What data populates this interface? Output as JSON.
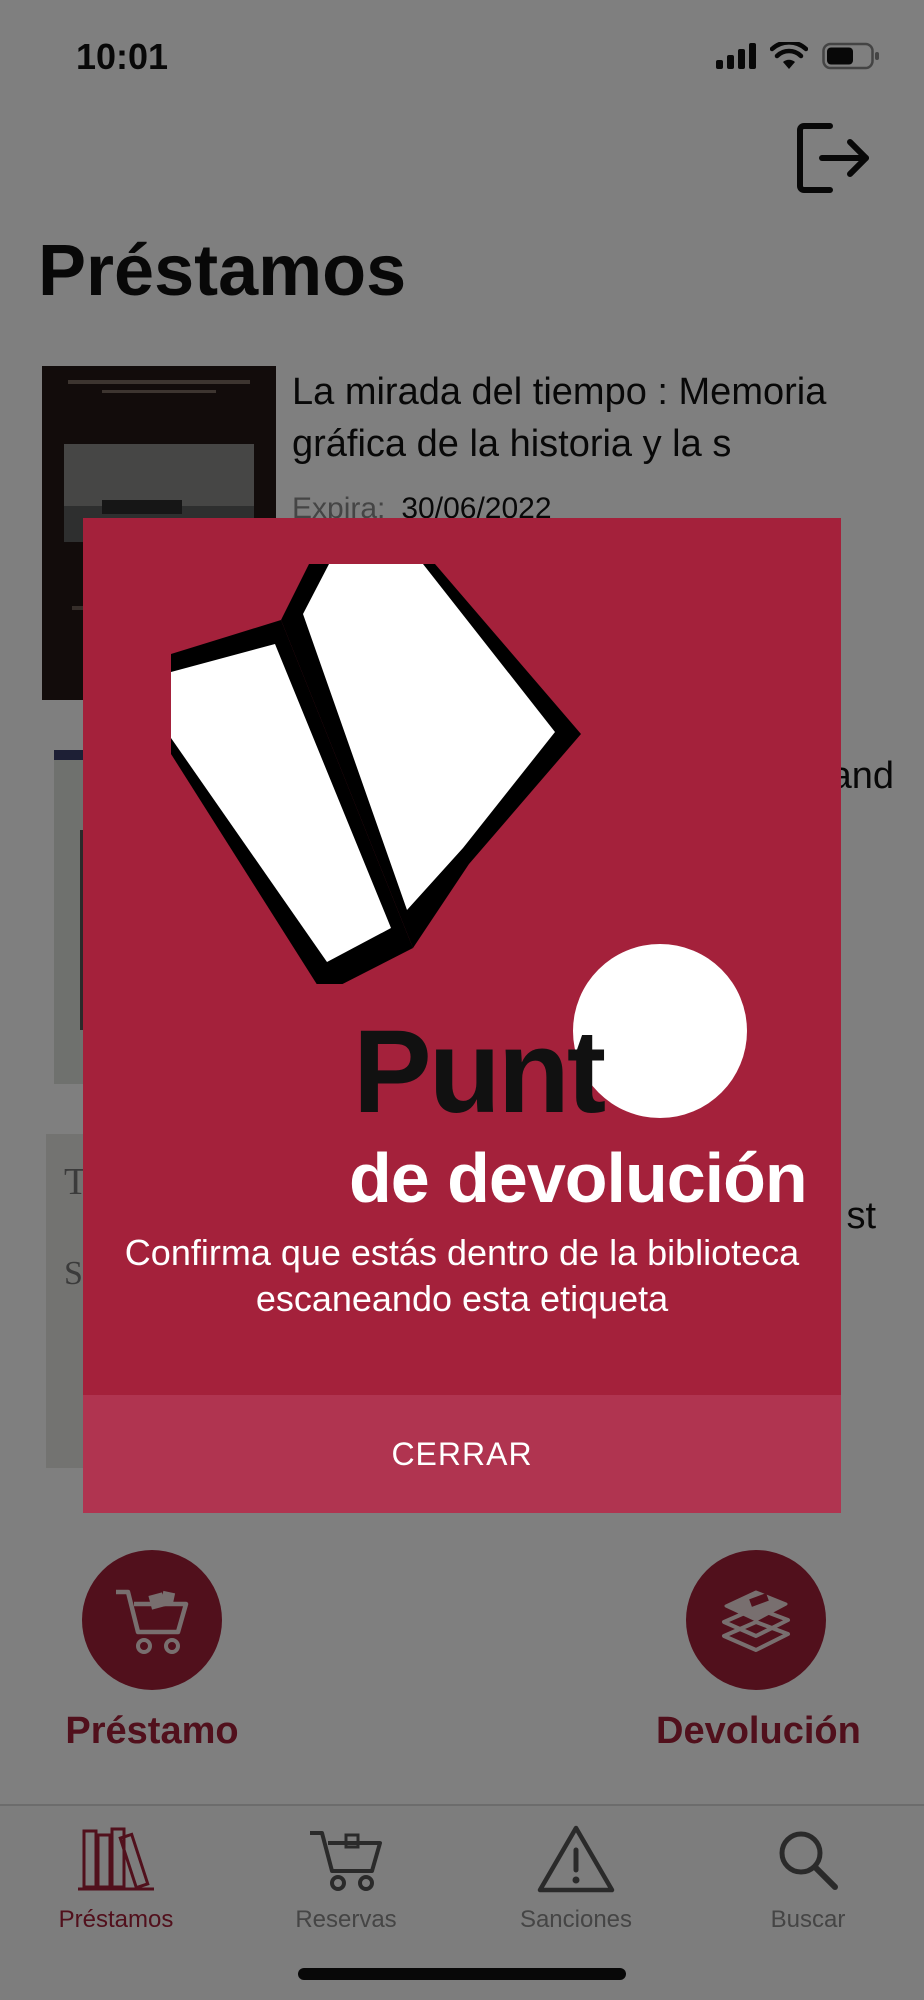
{
  "status_bar": {
    "time": "10:01"
  },
  "header": {
    "title": "Préstamos"
  },
  "loans": [
    {
      "title": "La mirada del tiempo : Memoria gráfica de la historia y la s",
      "expire_label": "Expira:",
      "expire_date": "30/06/2022"
    },
    {
      "title": "and",
      "expire_label": "",
      "expire_date": ""
    },
    {
      "title": "st",
      "expire_label": "",
      "expire_date": ""
    }
  ],
  "actions": {
    "loan_label": "Préstamo",
    "return_label": "Devolución"
  },
  "modal": {
    "logo_text_1": "Punt",
    "logo_text_2": "de devolución",
    "message": "Confirma que estás dentro de la biblioteca escaneando esta etiqueta",
    "close_label": "CERRAR"
  },
  "tabs": [
    {
      "label": "Préstamos",
      "icon": "books-icon",
      "active": true
    },
    {
      "label": "Reservas",
      "icon": "cart-icon",
      "active": false
    },
    {
      "label": "Sanciones",
      "icon": "warning-icon",
      "active": false
    },
    {
      "label": "Buscar",
      "icon": "search-icon",
      "active": false
    }
  ],
  "colors": {
    "accent": "#a32039",
    "modal_bg": "#a4213b",
    "modal_button": "#b03450"
  }
}
